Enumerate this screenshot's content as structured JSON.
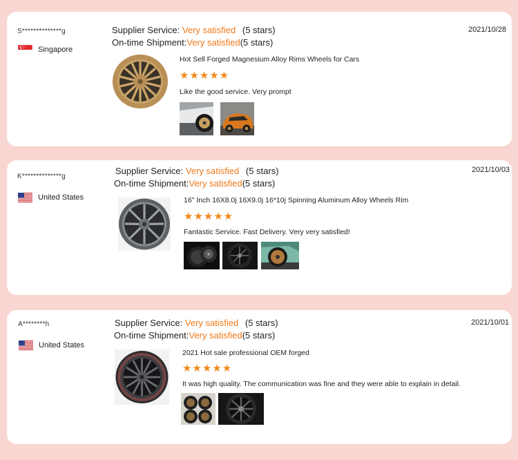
{
  "colors": {
    "background": "#f9d6d1",
    "card": "#ffffff",
    "accent": "#f07a1a",
    "stars": "#f08a1a"
  },
  "labels": {
    "supplier_service": "Supplier Service:",
    "ontime_shipment": "On-time Shipment:",
    "satisfaction": "Very satisfied",
    "stars_text": "(5 stars)",
    "star_glyphs": "★★★★★"
  },
  "reviews": [
    {
      "user": "S**************g",
      "country": "Singapore",
      "flag_icon": "singapore-flag-icon",
      "date": "2021/10/28",
      "product_title": "Hot Sell Forged Magnesium Alloy Rims Wheels for Cars",
      "rating": 5,
      "comment": "Like the good service. Very prompt"
    },
    {
      "user": "K**************g",
      "country": "United States",
      "flag_icon": "us-flag-icon",
      "date": "2021/10/03",
      "product_title": "16\" Inch 16X8.0j 16X9.0j 16*10j Spinning Aluminum Alloy Wheels Rim",
      "rating": 5,
      "comment": "Fantastic Service. Fast Delivery. Very very satisfied!"
    },
    {
      "user": "A********h",
      "country": "United States",
      "flag_icon": "us-flag-icon",
      "date": "2021/10/01",
      "product_title": "2021 Hot sale professional OEM forged",
      "rating": 5,
      "comment": "It was high quality. The communication was fine and they were able to explain in detail."
    }
  ]
}
